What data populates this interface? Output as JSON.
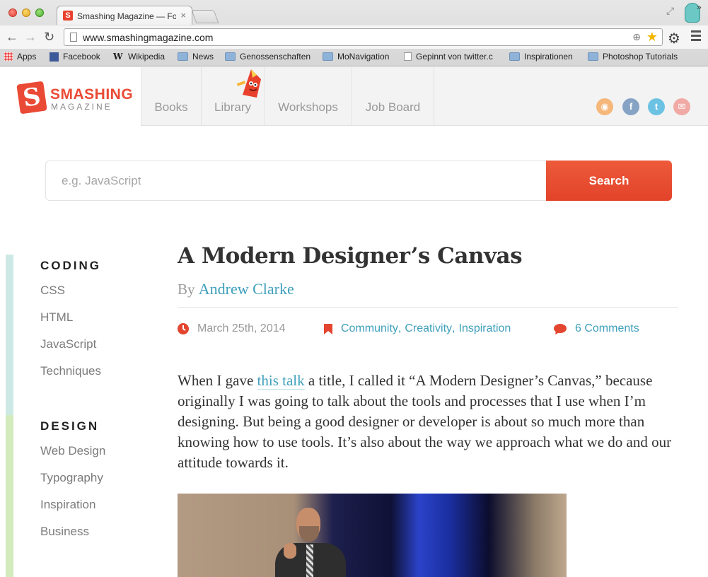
{
  "browser": {
    "tab_title": "Smashing Magazine — For Professional Web Designers and Developers",
    "tab_close": "×",
    "url": "www.smashingmagazine.com",
    "bookmarks": [
      {
        "label": "Apps",
        "icon": "apps-grid-icon"
      },
      {
        "label": "Facebook",
        "icon": "facebook-icon"
      },
      {
        "label": "Wikipedia",
        "icon": "wikipedia-icon"
      },
      {
        "label": "News",
        "icon": "folder-icon"
      },
      {
        "label": "Genossenschaften",
        "icon": "folder-icon"
      },
      {
        "label": "MoNavigation",
        "icon": "folder-icon"
      },
      {
        "label": "Gepinnt von twitter.c",
        "icon": "document-icon"
      },
      {
        "label": "Inspirationen",
        "icon": "folder-icon"
      },
      {
        "label": "Photoshop Tutorials",
        "icon": "folder-icon"
      }
    ],
    "bookmarks_more": "»"
  },
  "site": {
    "logo_letter": "S",
    "logo_word": "SMASHING",
    "logo_sub": "MAGAZINE",
    "nav": [
      "Books",
      "Library",
      "Workshops",
      "Job Board"
    ],
    "social": [
      "rss-icon",
      "facebook-icon",
      "twitter-icon",
      "newsletter-icon"
    ],
    "brand_color": "#ea4a35",
    "link_color": "#3e9fbb"
  },
  "search": {
    "placeholder": "e.g. JavaScript",
    "value": "",
    "button": "Search"
  },
  "sidebar": {
    "coding": {
      "heading": "CODING",
      "items": [
        "CSS",
        "HTML",
        "JavaScript",
        "Techniques"
      ]
    },
    "design": {
      "heading": "DESIGN",
      "items": [
        "Web Design",
        "Typography",
        "Inspiration",
        "Business"
      ]
    }
  },
  "article": {
    "title": "A Modern Designer’s Canvas",
    "by": "By",
    "author": "Andrew Clarke",
    "date": "March 25th, 2014",
    "categories": [
      "Community",
      "Creativity",
      "Inspiration"
    ],
    "comments": "6 Comments",
    "intro_before": "When I gave ",
    "intro_link": "this talk",
    "intro_after": " a title, I called it “A Modern Designer’s Canvas,” because originally I was going to talk about the tools and processes that I use when I’m designing. But being a good designer or developer is about so much more than knowing how to use tools. It’s also about the way we approach what we do and our attitude towards it."
  }
}
